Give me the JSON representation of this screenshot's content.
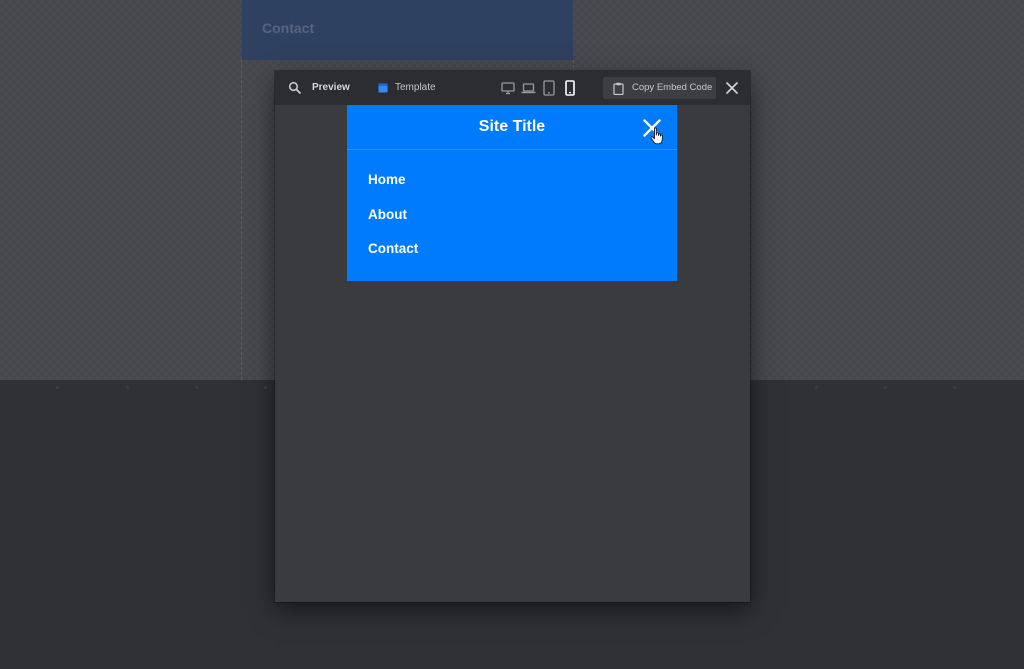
{
  "background": {
    "card_label": "Contact"
  },
  "toolbar": {
    "preview_label": "Preview",
    "template_label": "Template",
    "devices": [
      {
        "name": "desktop",
        "icon": "desktop-icon",
        "active": false
      },
      {
        "name": "laptop",
        "icon": "laptop-icon",
        "active": false
      },
      {
        "name": "tablet",
        "icon": "tablet-icon",
        "active": false
      },
      {
        "name": "mobile",
        "icon": "mobile-icon",
        "active": true
      }
    ],
    "copy_embed_label": "Copy Embed Code"
  },
  "site": {
    "title": "Site Title",
    "nav_items": [
      {
        "label": "Home"
      },
      {
        "label": "About"
      },
      {
        "label": "Contact"
      }
    ]
  },
  "colors": {
    "site_bg": "#017bfe",
    "toolbar_bg": "#2c2d31",
    "modal_bg": "#3a3b3f",
    "template_icon": "#2f8cff"
  }
}
